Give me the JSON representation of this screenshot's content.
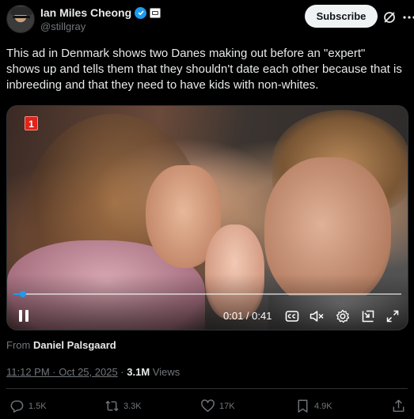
{
  "author": {
    "display_name": "Ian Miles Cheong",
    "handle": "@stillgray"
  },
  "header": {
    "subscribe_label": "Subscribe"
  },
  "tweet": {
    "text": "This ad in Denmark shows two Danes making out before an \"expert\" shows up and tells them that they shouldn't date each other because that is inbreeding and that they need to have kids with non-whites."
  },
  "video": {
    "notification_count": "1",
    "current_time": "0:01",
    "duration": "0:41",
    "time_display": "0:01 / 0:41",
    "progress_fraction": 0.024
  },
  "source": {
    "prefix": "From",
    "name": "Daniel Palsgaard"
  },
  "meta": {
    "timestamp": "11:12 PM · Oct 25, 2025",
    "separator": "·",
    "views_count": "3.1M",
    "views_label": "Views"
  },
  "actions": {
    "replies": "1.5K",
    "reposts": "3.3K",
    "likes": "17K",
    "bookmarks": "4.9K"
  },
  "colors": {
    "accent": "#1d9bf0",
    "background": "#000000",
    "muted_text": "#71767b",
    "primary_text": "#e7e9ea"
  }
}
